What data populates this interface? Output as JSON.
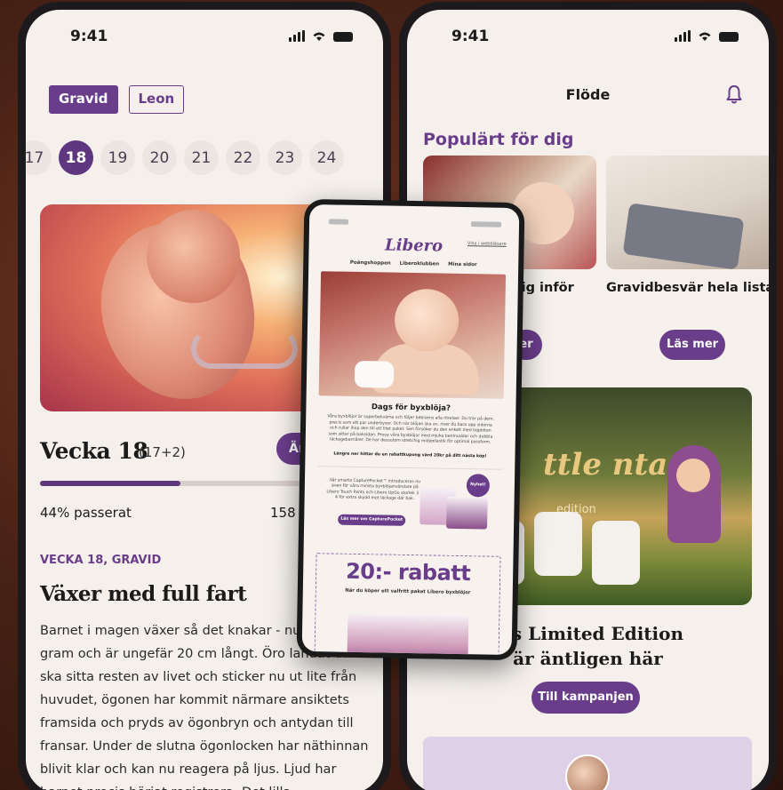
{
  "status": {
    "time_left": "9:41",
    "time_right": "9:41"
  },
  "left": {
    "chips": [
      "Gravid",
      "Leon"
    ],
    "weeks": [
      "17",
      "18",
      "19",
      "20",
      "21",
      "22",
      "23",
      "24"
    ],
    "active_week": "18",
    "week_title": "Vecka 18",
    "week_sub": "(17+2)",
    "change_button": "Änd",
    "progress": 0.44,
    "progress_label": "44% passerat",
    "days_left": "158 d",
    "kicker": "VECKA 18, GRAVID",
    "headline": "Växer med full fart",
    "body": "Barnet i magen växer så det knakar - nu v 250 gram och är ungefär 20 cm långt. Öro landat där de ska sitta resten av livet och sticker nu ut lite från huvudet, ögonen har kommit närmare ansiktets framsida och pryds av ögonbryn och antydan till fransar. Under de slutna ögonlocken har näthinnan blivit klar och kan nu reagera på ljus. Ljud har barnet precis börjat registrera. Det lilla"
  },
  "right": {
    "title": "Flöde",
    "bell_icon": "bell-icon",
    "section_title": "Populärt för dig",
    "card1_title": "sig inför",
    "card2_title": "Gravidbesvär hela listan",
    "card1_button": "er",
    "card2_button": "Läs mer",
    "campaign_art_title": "ttle ntasy",
    "campaign_art_edition": "edition",
    "campaign_text_line1": "ets Limited Edition",
    "campaign_text_line2": "är äntligen här",
    "campaign_button": "Till kampanjen"
  },
  "email": {
    "logo": "Libero",
    "web_link": "Visa i webbläsare",
    "nav": [
      "Poängshoppen",
      "Liberoklubben",
      "Mina sidor"
    ],
    "headline": "Dags för byxblöja?",
    "paragraph": "Våra byxblöjor är superbekväma och följer bebisens alla rörelser. Du trär på dem, precis som ett par underbyxor. Och när blöjan ska av, river du bara upp sidorna och rullar ihop den till ett litet paket. Sen försöker du den enkelt med tejpbiten som sitter på baksidan. Prova våra byxblöjor med mjuka benmuddar och dubbla läckagebarriärer. De har dessutom stretchig midjeelastik för optimal passform.",
    "paragraph_bold": "Längre ner hittar du en rabattkupong värd 20kr på ditt nästa köp!",
    "capture_text": "Vår smarta CapturePocket™ introduceras nu även för våra minsta byxblöjanvändare på Libero Touch Pants och Libero UpGo storlek 3 & 4 för extra skydd mot läckage där bak.",
    "capture_button": "Läs mer om CapturePocket",
    "badge": "Nyhet!",
    "rabatt": "20:- rabatt",
    "rabatt_sub": "När du köper ett valfritt paket Libero byxblöjor"
  },
  "colors": {
    "brand_purple": "#6a3d8a",
    "background": "#f5f0ec"
  }
}
